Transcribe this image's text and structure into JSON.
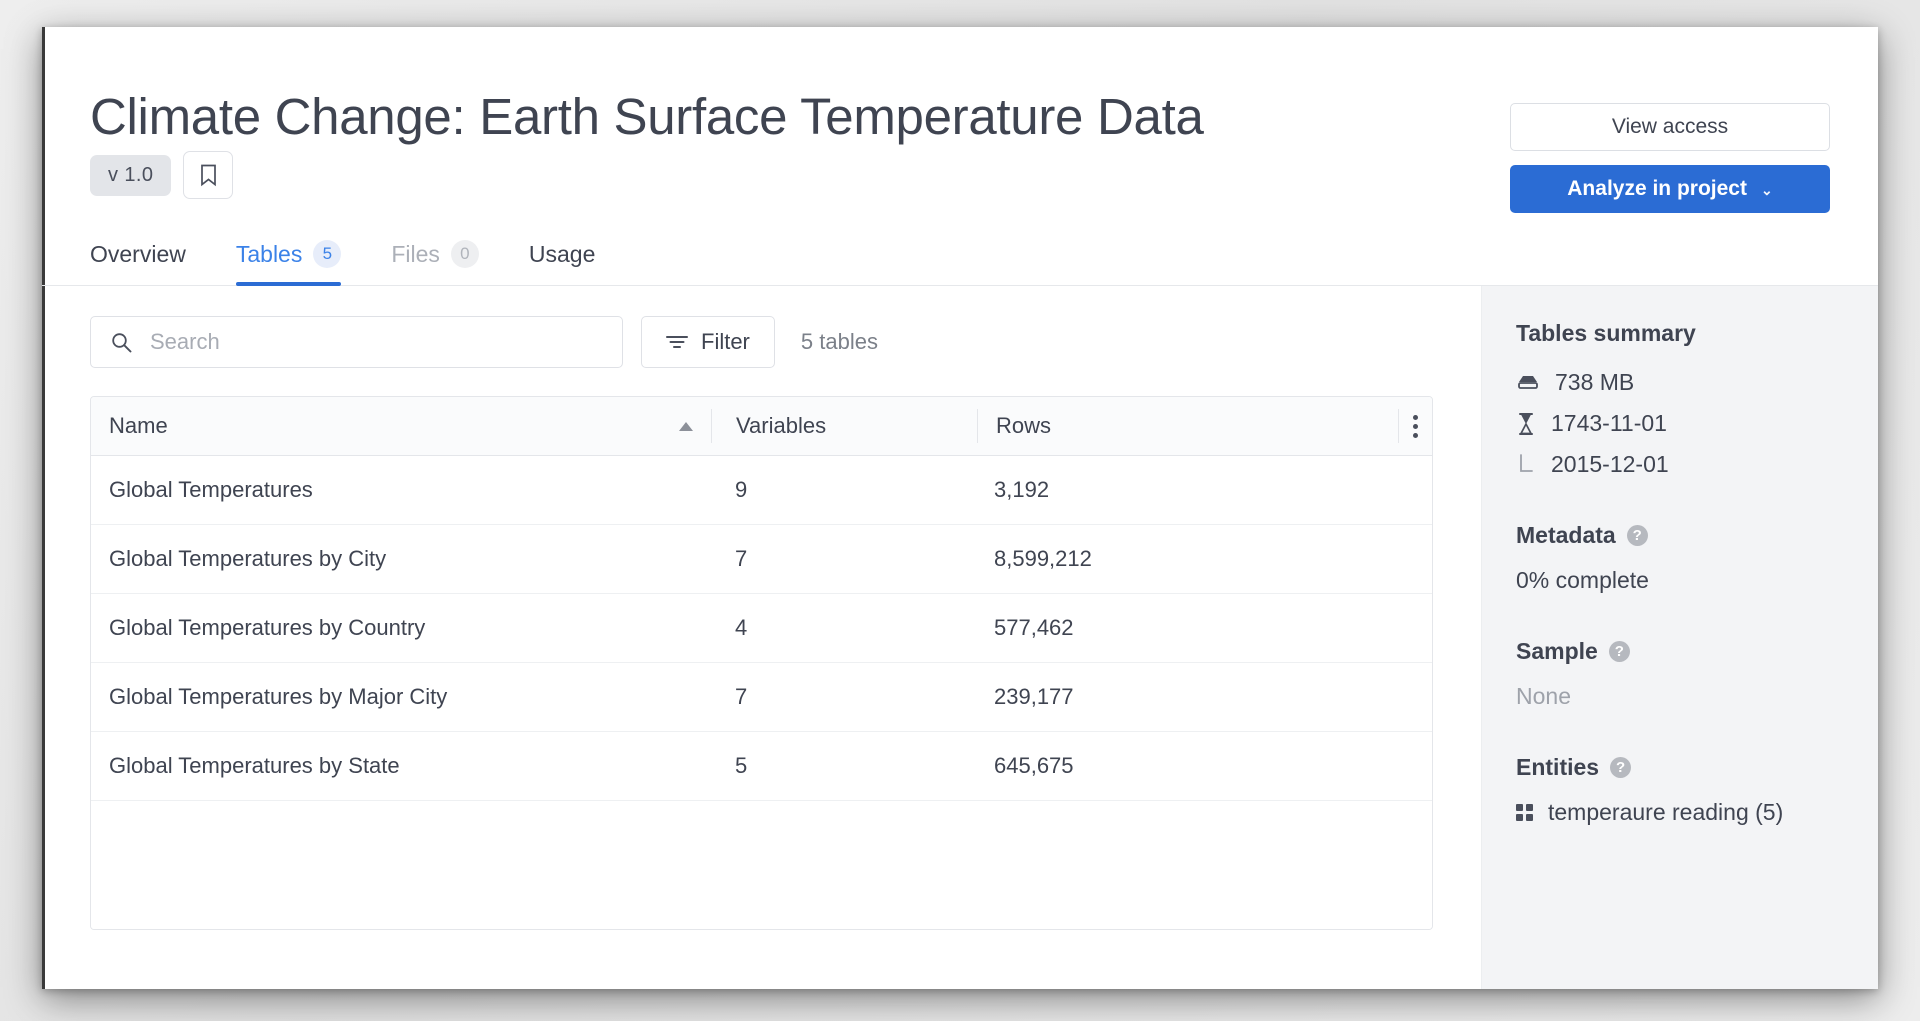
{
  "header": {
    "title": "Climate Change: Earth Surface Temperature Data",
    "version_badge": "v 1.0",
    "bookmark_icon": "bookmark-icon",
    "view_access_label": "View access",
    "analyze_label": "Analyze in project",
    "analyze_caret": "⌄"
  },
  "tabs": [
    {
      "label": "Overview",
      "count": null,
      "state": "normal"
    },
    {
      "label": "Tables",
      "count": "5",
      "state": "active"
    },
    {
      "label": "Files",
      "count": "0",
      "state": "muted"
    },
    {
      "label": "Usage",
      "count": null,
      "state": "normal"
    }
  ],
  "toolbar": {
    "search_placeholder": "Search",
    "search_value": "",
    "search_icon": "search-icon",
    "filter_label": "Filter",
    "filter_icon": "filter-icon",
    "tables_count_label": "5 tables"
  },
  "table": {
    "columns": [
      "Name",
      "Variables",
      "Rows"
    ],
    "sort_column": "Name",
    "sort_direction": "asc",
    "kebab_icon": "more-options-icon",
    "rows": [
      {
        "name": "Global Temperatures",
        "variables": "9",
        "rows": "3,192"
      },
      {
        "name": "Global Temperatures by City",
        "variables": "7",
        "rows": "8,599,212"
      },
      {
        "name": "Global Temperatures by Country",
        "variables": "4",
        "rows": "577,462"
      },
      {
        "name": "Global Temperatures by Major City",
        "variables": "7",
        "rows": "239,177"
      },
      {
        "name": "Global Temperatures by State",
        "variables": "5",
        "rows": "645,675"
      }
    ]
  },
  "sidebar": {
    "summary_title": "Tables summary",
    "size_value": "738 MB",
    "size_icon": "database-icon",
    "start_date": "1743-11-01",
    "start_icon": "hourglass-icon",
    "end_date": "2015-12-01",
    "end_icon": "branch-end-icon",
    "metadata_title": "Metadata",
    "metadata_value": "0% complete",
    "sample_title": "Sample",
    "sample_value": "None",
    "entities_title": "Entities",
    "entities_icon": "grid-icon",
    "entities_value": "temperaure reading (5)",
    "help_icon": "help-icon"
  },
  "colors": {
    "accent_blue": "#2b6cd4",
    "tab_active_text": "#3b82e8",
    "text_primary": "#3f4451",
    "text_muted": "#9ea2aa",
    "sidebar_bg": "#f3f4f6",
    "border": "#e4e6ea"
  }
}
